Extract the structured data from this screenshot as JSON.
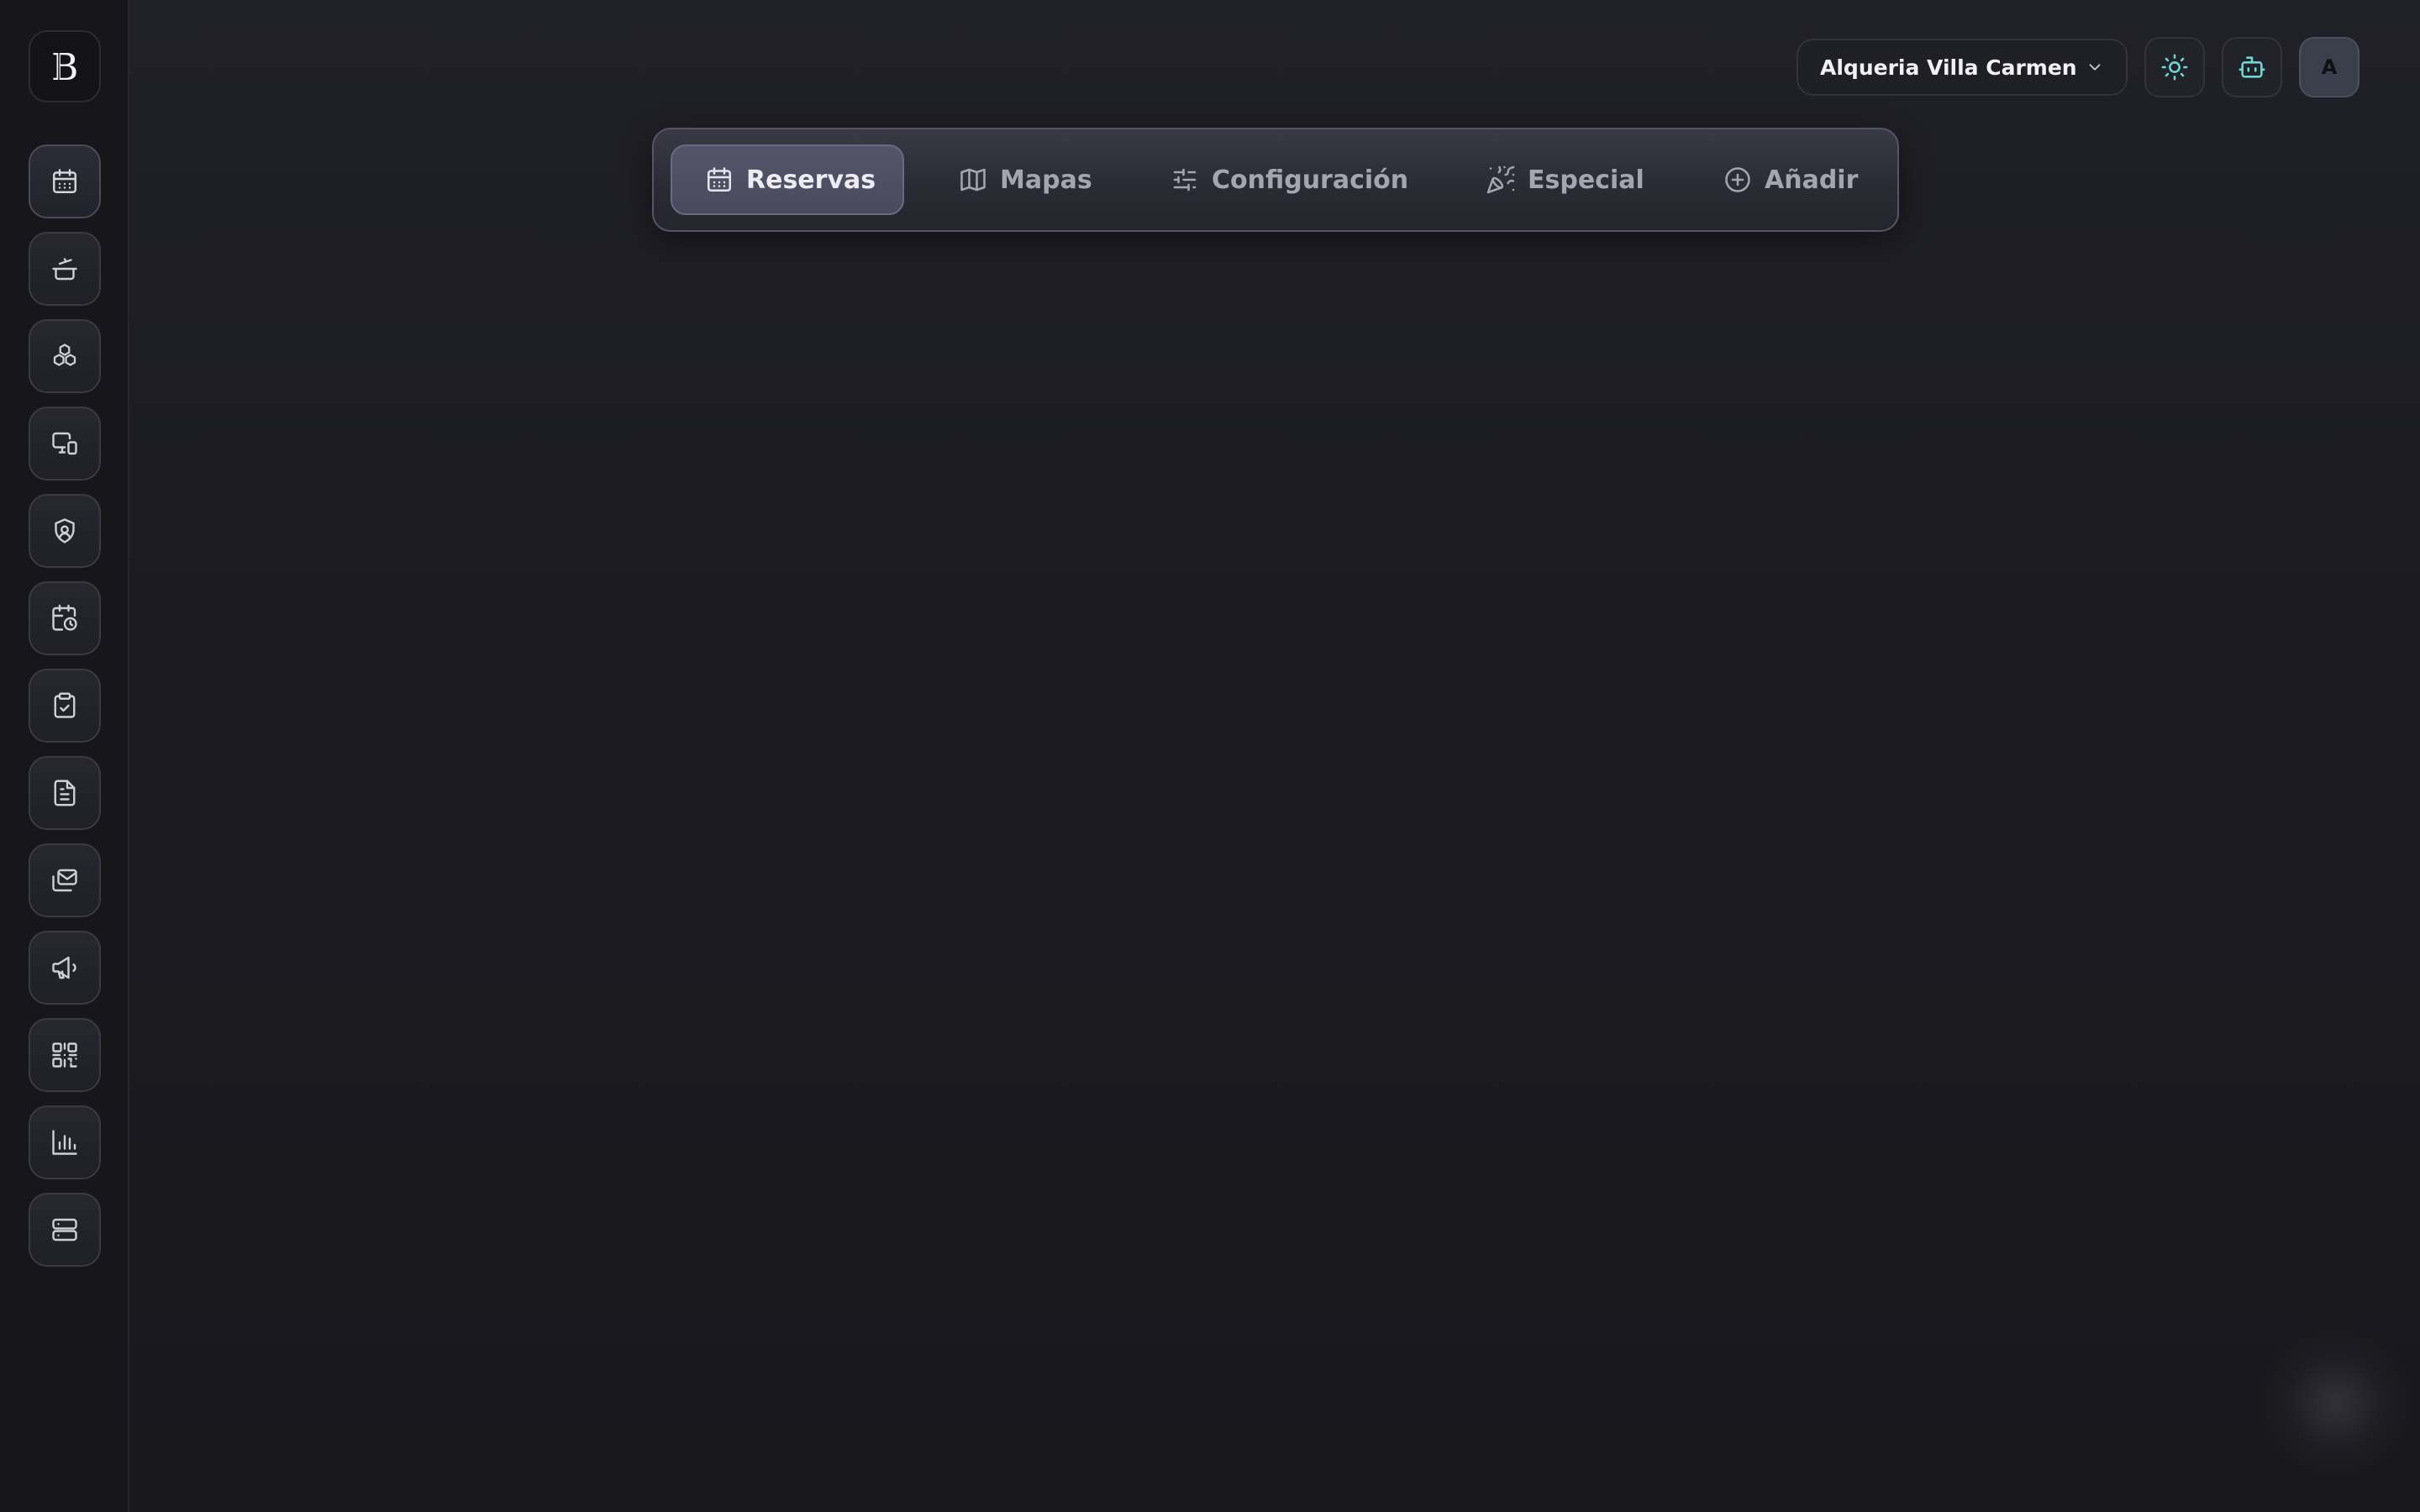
{
  "app": {
    "logo_text": "B"
  },
  "sidebar": {
    "items": [
      {
        "icon": "calendar-icon",
        "active": true
      },
      {
        "icon": "cooking-pot-icon",
        "active": false
      },
      {
        "icon": "boxes-icon",
        "active": false
      },
      {
        "icon": "monitor-smartphone-icon",
        "active": false
      },
      {
        "icon": "shield-user-icon",
        "active": false
      },
      {
        "icon": "calendar-clock-icon",
        "active": false
      },
      {
        "icon": "clipboard-check-icon",
        "active": false
      },
      {
        "icon": "file-text-icon",
        "active": false
      },
      {
        "icon": "mails-icon",
        "active": false
      },
      {
        "icon": "megaphone-icon",
        "active": false
      },
      {
        "icon": "qr-code-icon",
        "active": false
      },
      {
        "icon": "bar-chart-icon",
        "active": false
      },
      {
        "icon": "server-icon",
        "active": false
      }
    ]
  },
  "header": {
    "venue": "Alqueria Villa Carmen",
    "avatar_initial": "A"
  },
  "tabs": [
    {
      "label": "Reservas",
      "icon": "calendar-icon",
      "active": true
    },
    {
      "label": "Mapas",
      "icon": "map-icon",
      "active": false
    },
    {
      "label": "Configuración",
      "icon": "sliders-icon",
      "active": false
    },
    {
      "label": "Especial",
      "icon": "party-popper-icon",
      "active": false
    },
    {
      "label": "Añadir",
      "icon": "plus-circle-icon",
      "active": false
    }
  ],
  "colors": {
    "background": "#1c1c22",
    "accent_cyan": "#5fd3d3",
    "tab_active_bg": "#4f4f63"
  }
}
